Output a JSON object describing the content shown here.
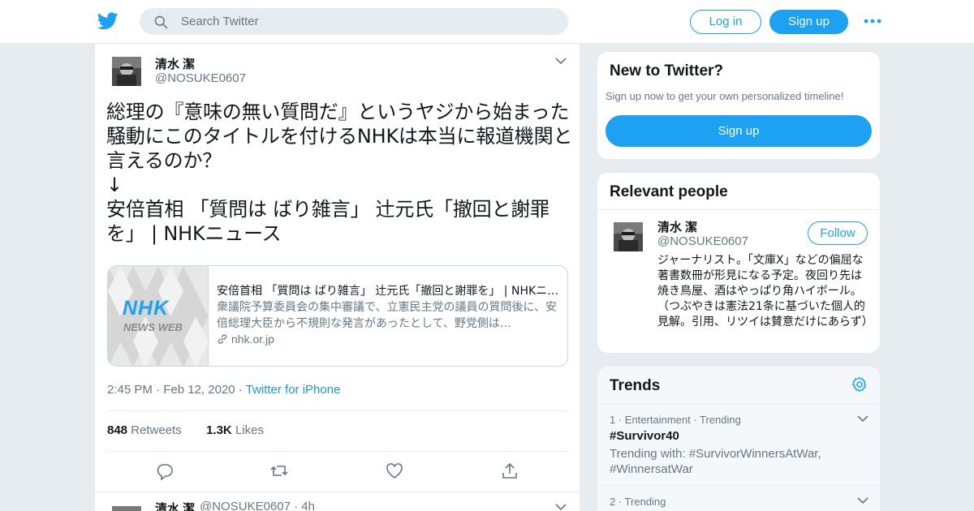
{
  "header": {
    "search_placeholder": "Search Twitter",
    "login_label": "Log in",
    "signup_label": "Sign up"
  },
  "tweet": {
    "author_name": "清水 潔",
    "author_handle": "@NOSUKE0607",
    "text": "総理の『意味の無い質問だ』というヤジから始まった\n騒動にこのタイトルを付けるNHKは本当に報道機関と\n言えるのか？\n↓\n安倍首相 「質問は ばり雑言」 辻元氏「撤回と謝罪\nを」 | NHKニュース",
    "card": {
      "logo_main": "NHK",
      "logo_sub": "NEWS WEB",
      "title": "安倍首相 「質問は ばり雑言」 辻元氏「撤回と謝罪を」 | NHKニュース",
      "description": "衆議院予算委員会の集中審議で、立憲民主党の議員の質問後に、安倍総理大臣から不規則な発言があったとして、野党側は…",
      "domain": "nhk.or.jp"
    },
    "time": "2:45 PM",
    "date": "Feb 12, 2020",
    "source": "Twitter for iPhone",
    "retweets_count": "848",
    "retweets_label": "Retweets",
    "likes_count": "1.3K",
    "likes_label": "Likes"
  },
  "next_tweet": {
    "author_name": "清水 潔",
    "handle_time": "@NOSUKE0607 · 4h"
  },
  "new_to_twitter": {
    "title": "New to Twitter?",
    "subtitle": "Sign up now to get your own personalized timeline!",
    "signup_label": "Sign up"
  },
  "relevant_people": {
    "title": "Relevant people",
    "name": "清水 潔",
    "handle": "@NOSUKE0607",
    "follow_label": "Follow",
    "bio": "ジャーナリスト。「文庫X」などの偏屈な著書数冊が形見になる予定。夜回り先は焼き鳥屋、酒はやっぱり角ハイボール。（つぶやきは憲法21条に基づいた個人的見解。引用、リツイは賛意だけにあらず）"
  },
  "trends": {
    "title": "Trends",
    "items": [
      {
        "meta": "1 · Entertainment · Trending",
        "name": "#Survivor40",
        "with": "Trending with: #SurvivorWinnersAtWar, #WinnersatWar"
      },
      {
        "meta": "2 · Trending",
        "name": "",
        "with": ""
      }
    ]
  },
  "colors": {
    "brand": "#1da1f2",
    "text": "#14171a",
    "secondary": "#657786",
    "background": "#e6ecf0"
  },
  "icons": [
    "twitter-bird-icon",
    "search-icon",
    "more-icon",
    "chevron-down-icon",
    "link-icon",
    "reply-icon",
    "retweet-icon",
    "like-icon",
    "share-icon",
    "gear-icon"
  ]
}
